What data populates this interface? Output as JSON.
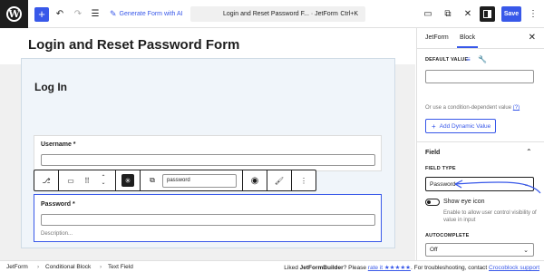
{
  "topbar": {
    "generate_label": "Generate Form with AI",
    "doc_title": "Login and Reset Password F... · JetForm",
    "shortcut": "Ctrl+K",
    "save_label": "Save"
  },
  "canvas": {
    "page_title": "Login and Reset Password Form",
    "form_title": "Log In",
    "username_label": "Username *",
    "password_label": "Password *",
    "password_description": "Description..."
  },
  "toolbar": {
    "field_name": "password"
  },
  "sidebar": {
    "tabs": [
      "JetForm",
      "Block"
    ],
    "active_tab": "Block",
    "default_value_label": "DEFAULT VALUE",
    "condition_text": "Or use a condition-dependent value",
    "condition_link": "(?)",
    "add_dynamic_label": "Add Dynamic Value",
    "field_section": "Field",
    "field_type_label": "FIELD TYPE",
    "field_type_value": "Password",
    "show_eye_label": "Show eye icon",
    "show_eye_help": "Enable to allow user control visibility of value in input",
    "autocomplete_label": "AUTOCOMPLETE",
    "autocomplete_value": "Off"
  },
  "footer": {
    "breadcrumbs": [
      "JetForm",
      "Conditional Block",
      "Text Field"
    ],
    "liked_prefix": "Liked ",
    "brand": "JetFormBuilder",
    "please": "? Please ",
    "rate_link": "rate it ★★★★★",
    "troubleshoot": ". For troubleshooting, contact ",
    "support_link": "Crocoblock support"
  },
  "colors": {
    "accent": "#3858e9",
    "dark": "#1e1e1e",
    "canvas_bg": "#f0f0f0",
    "form_bg": "#f0f5fa"
  }
}
